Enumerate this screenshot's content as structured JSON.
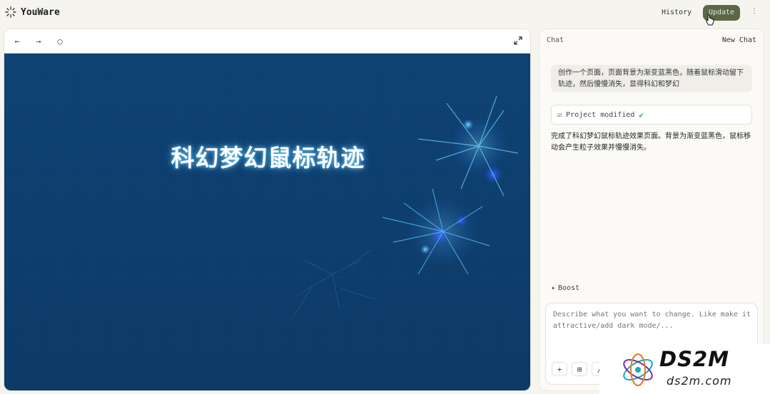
{
  "app": {
    "name": "YouWare"
  },
  "header": {
    "history_label": "History",
    "update_label": "Update",
    "more_label": "⋮"
  },
  "preview": {
    "title": "科幻梦幻鼠标轨迹"
  },
  "chat": {
    "title": "Chat",
    "new_chat_label": "New Chat",
    "user_message": "创作一个页面，页面背景为渐变蓝黑色，随着鼠标滑动留下轨迹，然后慢慢消失，显得科幻和梦幻",
    "project_status": "Project modified",
    "assistant_message": "完成了科幻梦幻鼠标轨迹效果页面。背景为渐变蓝黑色，鼠标移动会产生粒子效果并慢慢消失。",
    "boost_label": "Boost",
    "input_placeholder": "Describe what you want to change. Like make it attractive/add dark mode/..."
  },
  "watermark": {
    "main": "DS2M",
    "sub": "ds2m.com"
  },
  "colors": {
    "update_bg": "#5b6848",
    "canvas_top": "#0b3f72",
    "canvas_bottom": "#093763",
    "glow": "#7fe0ff"
  }
}
